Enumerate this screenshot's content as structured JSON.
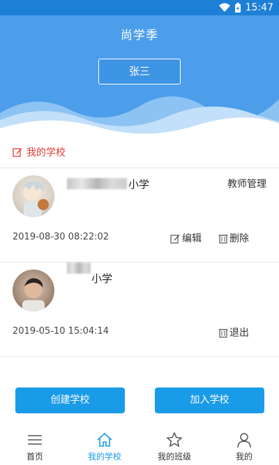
{
  "status_bar": {
    "time": "15:47"
  },
  "header": {
    "app_title": "尚学季",
    "user_name": "张三"
  },
  "section": {
    "title": "我的学校"
  },
  "schools": [
    {
      "name_suffix": "小学",
      "role": "教师管理",
      "created": "2019-08-30 08:22:02",
      "actions": [
        "编辑",
        "删除"
      ]
    },
    {
      "name_suffix": "小学",
      "role": "",
      "created": "2019-05-10 15:04:14",
      "actions": [
        "退出"
      ]
    }
  ],
  "buttons": {
    "create": "创建学校",
    "join": "加入学校"
  },
  "tabs": [
    "首页",
    "我的学校",
    "我的班级",
    "我的"
  ],
  "colors": {
    "header": "#4c9eea",
    "accent": "#1a9be8",
    "section_title": "#e53935"
  }
}
